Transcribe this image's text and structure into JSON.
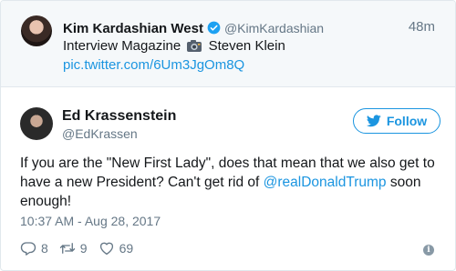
{
  "quoted_tweet": {
    "author_name": "Kim Kardashian West",
    "author_handle": "@KimKardashian",
    "time": "48m",
    "text_before": "Interview Magazine",
    "text_after": "Steven Klein",
    "link": "pic.twitter.com/6Um3JgOm8Q"
  },
  "tweet": {
    "author_name": "Ed Krassenstein",
    "author_handle": "@EdKrassen",
    "follow_label": "Follow",
    "text_before_mention": "If you are the \"New First Lady\", does that mean that we also get to have a new President? Can't get rid of ",
    "mention": "@realDonaldTrump",
    "text_after_mention": " soon enough!",
    "timestamp": "10:37 AM - Aug 28, 2017"
  },
  "actions": {
    "replies": "8",
    "retweets": "9",
    "likes": "69"
  },
  "icons": {
    "verified": "verified-badge-icon",
    "camera": "camera-emoji-icon",
    "bird": "twitter-bird-icon",
    "reply": "reply-icon",
    "retweet": "retweet-icon",
    "like": "heart-icon",
    "info": "info-icon"
  },
  "colors": {
    "accent": "#1b95e0",
    "muted": "#657786",
    "parent_bg": "#f5f8fa",
    "verified": "#1da1f2"
  }
}
